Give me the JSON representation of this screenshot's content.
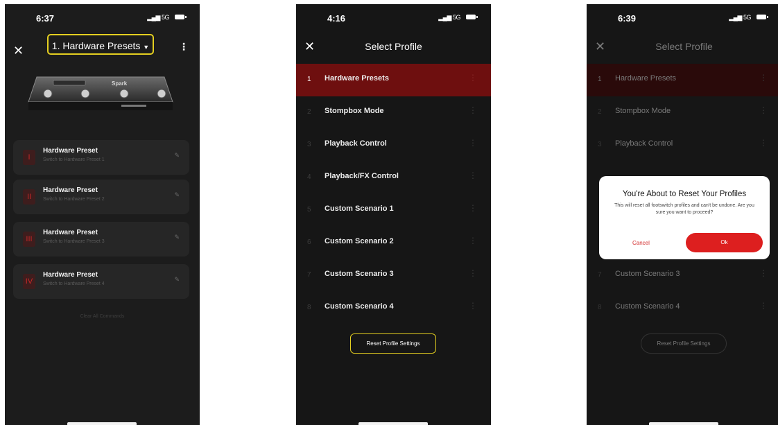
{
  "screen1": {
    "time": "6:37",
    "network": "5G",
    "profile_button": "1. Hardware Presets",
    "pedal_brand": "Spark",
    "cards": [
      {
        "num": "I",
        "title": "Hardware Preset",
        "sub": "Switch to Hardware Preset 1"
      },
      {
        "num": "II",
        "title": "Hardware Preset",
        "sub": "Switch to Hardware Preset 2"
      },
      {
        "num": "III",
        "title": "Hardware Preset",
        "sub": "Switch to Hardware Preset 3"
      },
      {
        "num": "IV",
        "title": "Hardware Preset",
        "sub": "Switch to Hardware Preset 4"
      }
    ],
    "clear_label": "Clear All Commands"
  },
  "screen2": {
    "time": "4:16",
    "network": "5G",
    "title": "Select Profile",
    "profiles": [
      {
        "idx": "1",
        "label": "Hardware Presets"
      },
      {
        "idx": "2",
        "label": "Stompbox Mode"
      },
      {
        "idx": "3",
        "label": "Playback Control"
      },
      {
        "idx": "4",
        "label": "Playback/FX Control"
      },
      {
        "idx": "5",
        "label": "Custom Scenario 1"
      },
      {
        "idx": "6",
        "label": "Custom Scenario 2"
      },
      {
        "idx": "7",
        "label": "Custom Scenario 3"
      },
      {
        "idx": "8",
        "label": "Custom Scenario 4"
      }
    ],
    "reset_label": "Reset Profile Settings"
  },
  "screen3": {
    "time": "6:39",
    "network": "5G",
    "title": "Select Profile",
    "profiles": [
      {
        "idx": "1",
        "label": "Hardware Presets"
      },
      {
        "idx": "2",
        "label": "Stompbox Mode"
      },
      {
        "idx": "3",
        "label": "Playback Control"
      },
      {
        "idx": "7",
        "label": "Custom Scenario 3"
      },
      {
        "idx": "8",
        "label": "Custom Scenario 4"
      }
    ],
    "reset_label": "Reset Profile Settings",
    "dialog": {
      "title": "You're About to Reset Your Profiles",
      "message": "This will reset all footswitch profiles and can't be undone. Are you sure you want to proceed?",
      "cancel": "Cancel",
      "ok": "Ok"
    }
  },
  "colors": {
    "accent_red": "#dd1f1f",
    "highlight_yellow": "#e4cf20",
    "selected_row": "#6e0f0f"
  }
}
